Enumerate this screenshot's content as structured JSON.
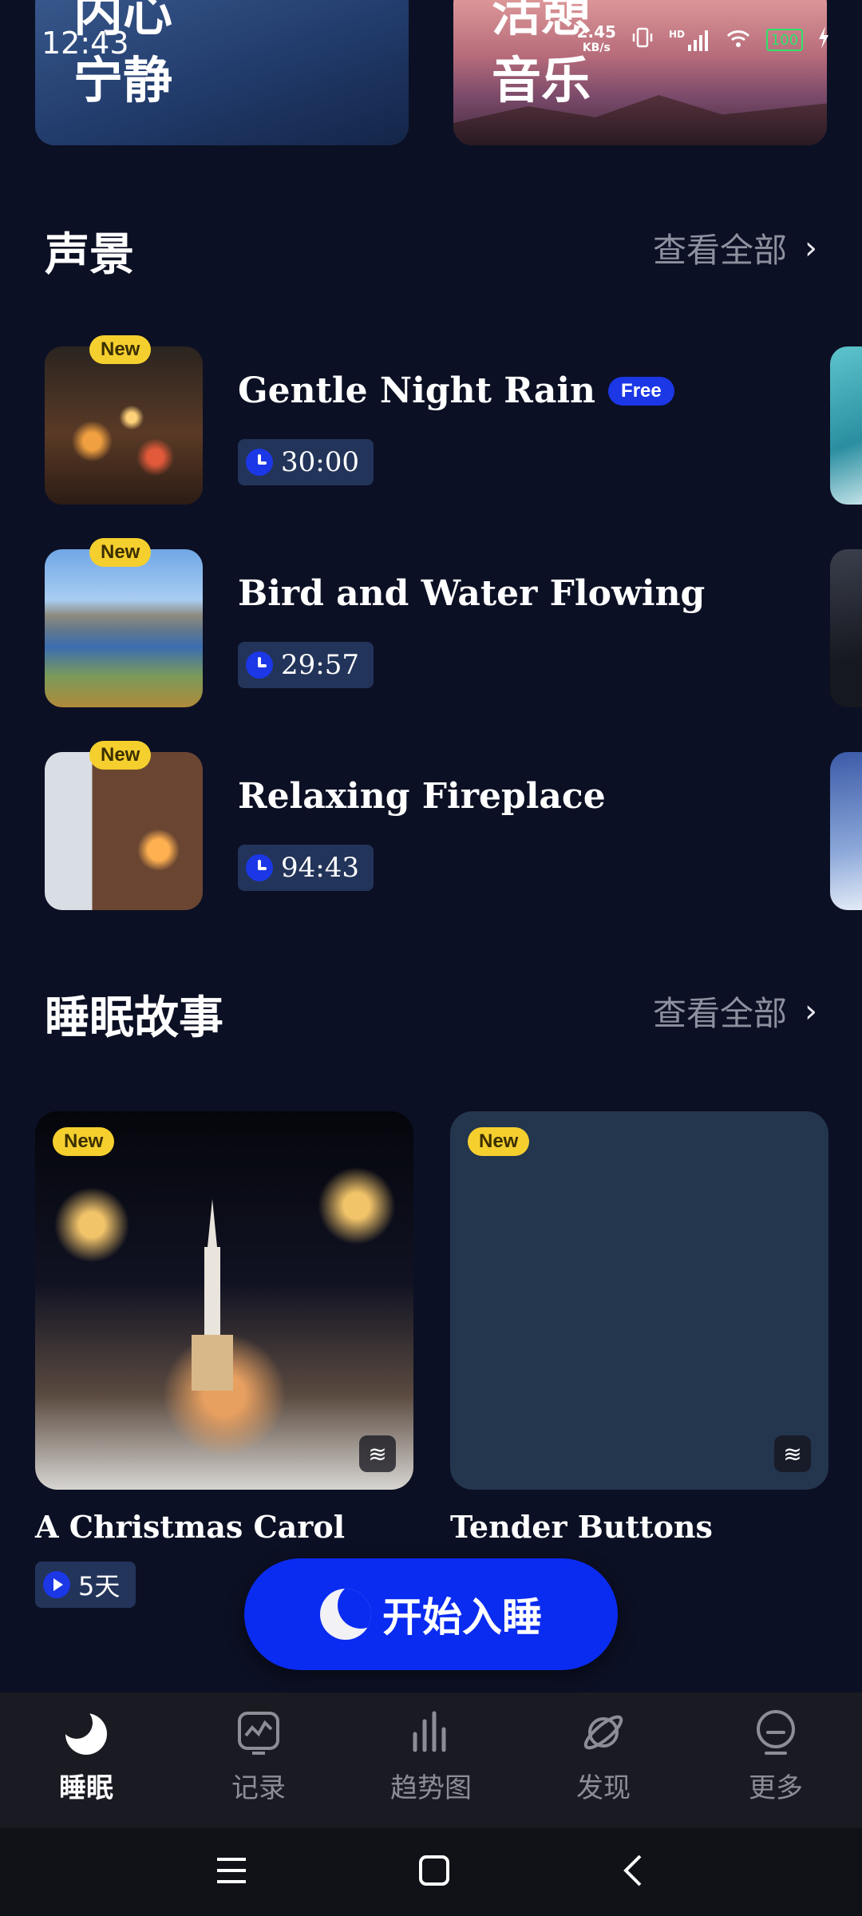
{
  "status_bar": {
    "time": "12:43",
    "net_speed": "2.45",
    "net_unit": "KB/s",
    "hd": "HD",
    "battery": "100"
  },
  "top_cards": [
    {
      "line1": "内心",
      "line2": "宁静"
    },
    {
      "line1": "活憩",
      "line2": "音乐"
    }
  ],
  "soundscape": {
    "title": "声景",
    "see_all": "查看全部",
    "items": [
      {
        "badge": "New",
        "title": "Gentle Night Rain",
        "tag": "Free",
        "duration": "30:00"
      },
      {
        "badge": "New",
        "title": "Bird and Water Flowing",
        "tag": "",
        "duration": "29:57"
      },
      {
        "badge": "New",
        "title": "Relaxing Fireplace",
        "tag": "",
        "duration": "94:43"
      }
    ]
  },
  "stories": {
    "title": "睡眠故事",
    "see_all": "查看全部",
    "items": [
      {
        "badge": "New",
        "title": "A Christmas Carol",
        "days": "5天"
      },
      {
        "badge": "New",
        "title": "Tender Buttons"
      }
    ]
  },
  "start_button": {
    "label": "开始入睡"
  },
  "bottom_nav": [
    {
      "label": "睡眠",
      "icon": "moon-icon",
      "active": true
    },
    {
      "label": "记录",
      "icon": "chart-card-icon",
      "active": false
    },
    {
      "label": "趋势图",
      "icon": "bars-icon",
      "active": false
    },
    {
      "label": "发现",
      "icon": "planet-icon",
      "active": false
    },
    {
      "label": "更多",
      "icon": "face-icon",
      "active": false
    }
  ],
  "colors": {
    "background": "#0c1024",
    "accent": "#0a2bf0",
    "badge_yellow": "#f5cf2e",
    "muted_text": "#8d909e"
  }
}
